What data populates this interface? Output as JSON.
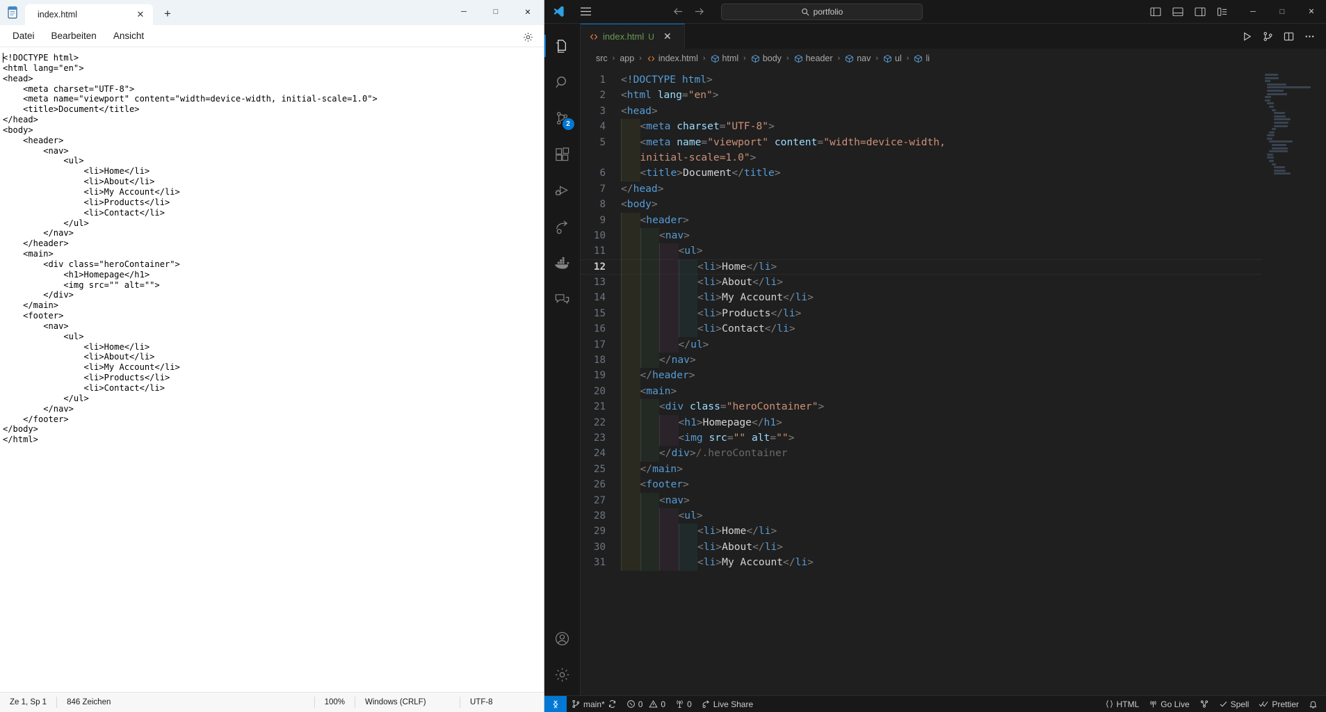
{
  "notepad": {
    "app_icon": "notepad-icon",
    "tab": {
      "label": "index.html",
      "close": "✕"
    },
    "new_tab": "+",
    "window_controls": {
      "minimize": "─",
      "maximize": "□",
      "close": "✕"
    },
    "menu": [
      "Datei",
      "Bearbeiten",
      "Ansicht"
    ],
    "settings_icon": "gear-icon",
    "content": "<!DOCTYPE html>\n<html lang=\"en\">\n<head>\n    <meta charset=\"UTF-8\">\n    <meta name=\"viewport\" content=\"width=device-width, initial-scale=1.0\">\n    <title>Document</title>\n</head>\n<body>\n    <header>\n        <nav>\n            <ul>\n                <li>Home</li>\n                <li>About</li>\n                <li>My Account</li>\n                <li>Products</li>\n                <li>Contact</li>\n            </ul>\n        </nav>\n    </header>\n    <main>\n        <div class=\"heroContainer\">\n            <h1>Homepage</h1>\n            <img src=\"\" alt=\"\">\n        </div>\n    </main>\n    <footer>\n        <nav>\n            <ul>\n                <li>Home</li>\n                <li>About</li>\n                <li>My Account</li>\n                <li>Products</li>\n                <li>Contact</li>\n            </ul>\n        </nav>\n    </footer>\n</body>\n</html>",
    "statusbar": {
      "position": "Ze 1, Sp 1",
      "characters": "846 Zeichen",
      "zoom": "100%",
      "line_ending": "Windows (CRLF)",
      "encoding": "UTF-8"
    }
  },
  "vscode": {
    "titlebar": {
      "logo": "vscode-logo-icon",
      "menu_icon": "hamburger-menu-icon",
      "back_icon": "arrow-left-icon",
      "forward_icon": "arrow-right-icon",
      "search_icon": "search-icon",
      "search_value": "portfolio",
      "layout_icons": [
        "toggle-primary-sidebar-icon",
        "toggle-panel-icon",
        "toggle-secondary-sidebar-icon",
        "customize-layout-icon"
      ],
      "window_controls": {
        "minimize": "─",
        "maximize": "□",
        "close": "✕"
      }
    },
    "activitybar": [
      {
        "name": "explorer",
        "icon": "files-icon",
        "badge": null,
        "active": true
      },
      {
        "name": "search",
        "icon": "search-icon",
        "badge": null,
        "active": false
      },
      {
        "name": "source-control",
        "icon": "source-control-icon",
        "badge": "2",
        "active": false
      },
      {
        "name": "extensions",
        "icon": "extensions-icon",
        "badge": null,
        "active": false
      },
      {
        "name": "run-and-debug",
        "icon": "run-debug-icon",
        "badge": null,
        "active": false
      },
      {
        "name": "live-share",
        "icon": "share-icon",
        "badge": null,
        "active": false
      },
      {
        "name": "docker",
        "icon": "docker-whale-icon",
        "badge": null,
        "active": false
      },
      {
        "name": "remote-explorer",
        "icon": "remote-window-icon",
        "badge": null,
        "active": false
      }
    ],
    "activitybar_bottom": [
      {
        "name": "accounts",
        "icon": "account-icon"
      },
      {
        "name": "settings",
        "icon": "gear-icon"
      }
    ],
    "tab": {
      "icon": "html-file-icon",
      "label": "index.html",
      "status_badge": "U",
      "close": "✕"
    },
    "editor_actions": [
      "run-file-icon",
      "split-and-compare-icon",
      "split-editor-icon",
      "more-actions-icon"
    ],
    "breadcrumb": [
      {
        "label": "src",
        "icon": null
      },
      {
        "label": "app",
        "icon": null
      },
      {
        "label": "index.html",
        "icon": "html-file-icon"
      },
      {
        "label": "html",
        "icon": "symbol-module-icon"
      },
      {
        "label": "body",
        "icon": "symbol-module-icon"
      },
      {
        "label": "header",
        "icon": "symbol-module-icon"
      },
      {
        "label": "nav",
        "icon": "symbol-module-icon"
      },
      {
        "label": "ul",
        "icon": "symbol-module-icon"
      },
      {
        "label": "li",
        "icon": "symbol-module-icon"
      }
    ],
    "breadcrumb_separator": "›",
    "code_lines": [
      {
        "n": 1,
        "indent": 0,
        "tokens": [
          [
            "ang",
            "<"
          ],
          [
            "doct",
            "!DOCTYPE "
          ],
          [
            "tag",
            "html"
          ],
          [
            "ang",
            ">"
          ]
        ]
      },
      {
        "n": 2,
        "indent": 0,
        "tokens": [
          [
            "ang",
            "<"
          ],
          [
            "tag",
            "html"
          ],
          [
            "txt",
            " "
          ],
          [
            "attr",
            "lang"
          ],
          [
            "ang",
            "="
          ],
          [
            "str",
            "\"en\""
          ],
          [
            "ang",
            ">"
          ]
        ]
      },
      {
        "n": 3,
        "indent": 0,
        "tokens": [
          [
            "ang",
            "<"
          ],
          [
            "tag",
            "head"
          ],
          [
            "ang",
            ">"
          ]
        ]
      },
      {
        "n": 4,
        "indent": 1,
        "tokens": [
          [
            "ang",
            "<"
          ],
          [
            "tag",
            "meta"
          ],
          [
            "txt",
            " "
          ],
          [
            "attr",
            "charset"
          ],
          [
            "ang",
            "="
          ],
          [
            "str",
            "\"UTF-8\""
          ],
          [
            "ang",
            ">"
          ]
        ]
      },
      {
        "n": 5,
        "indent": 1,
        "tokens": [
          [
            "ang",
            "<"
          ],
          [
            "tag",
            "meta"
          ],
          [
            "txt",
            " "
          ],
          [
            "attr",
            "name"
          ],
          [
            "ang",
            "="
          ],
          [
            "str",
            "\"viewport\""
          ],
          [
            "txt",
            " "
          ],
          [
            "attr",
            "content"
          ],
          [
            "ang",
            "="
          ],
          [
            "str",
            "\"width=device-width,"
          ]
        ]
      },
      {
        "n": "",
        "indent": 1,
        "wrap": true,
        "tokens": [
          [
            "str",
            "initial-scale=1.0\""
          ],
          [
            "ang",
            ">"
          ]
        ]
      },
      {
        "n": 6,
        "indent": 1,
        "tokens": [
          [
            "ang",
            "<"
          ],
          [
            "tag",
            "title"
          ],
          [
            "ang",
            ">"
          ],
          [
            "txt",
            "Document"
          ],
          [
            "ang",
            "</"
          ],
          [
            "tag",
            "title"
          ],
          [
            "ang",
            ">"
          ]
        ]
      },
      {
        "n": 7,
        "indent": 0,
        "tokens": [
          [
            "ang",
            "</"
          ],
          [
            "tag",
            "head"
          ],
          [
            "ang",
            ">"
          ]
        ]
      },
      {
        "n": 8,
        "indent": 0,
        "tokens": [
          [
            "ang",
            "<"
          ],
          [
            "tag",
            "body"
          ],
          [
            "ang",
            ">"
          ]
        ]
      },
      {
        "n": 9,
        "indent": 1,
        "tokens": [
          [
            "ang",
            "<"
          ],
          [
            "tag",
            "header"
          ],
          [
            "ang",
            ">"
          ]
        ]
      },
      {
        "n": 10,
        "indent": 2,
        "tokens": [
          [
            "ang",
            "<"
          ],
          [
            "tag",
            "nav"
          ],
          [
            "ang",
            ">"
          ]
        ]
      },
      {
        "n": 11,
        "indent": 3,
        "tokens": [
          [
            "ang",
            "<"
          ],
          [
            "tag",
            "ul"
          ],
          [
            "ang",
            ">"
          ]
        ]
      },
      {
        "n": 12,
        "indent": 4,
        "active": true,
        "tokens": [
          [
            "ang",
            "<"
          ],
          [
            "tag",
            "li"
          ],
          [
            "ang",
            ">"
          ],
          [
            "txt",
            "Home"
          ],
          [
            "ang",
            "</"
          ],
          [
            "tag",
            "li"
          ],
          [
            "ang",
            ">"
          ]
        ]
      },
      {
        "n": 13,
        "indent": 4,
        "tokens": [
          [
            "ang",
            "<"
          ],
          [
            "tag",
            "li"
          ],
          [
            "ang",
            ">"
          ],
          [
            "txt",
            "About"
          ],
          [
            "ang",
            "</"
          ],
          [
            "tag",
            "li"
          ],
          [
            "ang",
            ">"
          ]
        ]
      },
      {
        "n": 14,
        "indent": 4,
        "tokens": [
          [
            "ang",
            "<"
          ],
          [
            "tag",
            "li"
          ],
          [
            "ang",
            ">"
          ],
          [
            "txt",
            "My Account"
          ],
          [
            "ang",
            "</"
          ],
          [
            "tag",
            "li"
          ],
          [
            "ang",
            ">"
          ]
        ]
      },
      {
        "n": 15,
        "indent": 4,
        "tokens": [
          [
            "ang",
            "<"
          ],
          [
            "tag",
            "li"
          ],
          [
            "ang",
            ">"
          ],
          [
            "txt",
            "Products"
          ],
          [
            "ang",
            "</"
          ],
          [
            "tag",
            "li"
          ],
          [
            "ang",
            ">"
          ]
        ]
      },
      {
        "n": 16,
        "indent": 4,
        "tokens": [
          [
            "ang",
            "<"
          ],
          [
            "tag",
            "li"
          ],
          [
            "ang",
            ">"
          ],
          [
            "txt",
            "Contact"
          ],
          [
            "ang",
            "</"
          ],
          [
            "tag",
            "li"
          ],
          [
            "ang",
            ">"
          ]
        ]
      },
      {
        "n": 17,
        "indent": 3,
        "tokens": [
          [
            "ang",
            "</"
          ],
          [
            "tag",
            "ul"
          ],
          [
            "ang",
            ">"
          ]
        ]
      },
      {
        "n": 18,
        "indent": 2,
        "tokens": [
          [
            "ang",
            "</"
          ],
          [
            "tag",
            "nav"
          ],
          [
            "ang",
            ">"
          ]
        ]
      },
      {
        "n": 19,
        "indent": 1,
        "tokens": [
          [
            "ang",
            "</"
          ],
          [
            "tag",
            "header"
          ],
          [
            "ang",
            ">"
          ]
        ]
      },
      {
        "n": 20,
        "indent": 1,
        "tokens": [
          [
            "ang",
            "<"
          ],
          [
            "tag",
            "main"
          ],
          [
            "ang",
            ">"
          ]
        ]
      },
      {
        "n": 21,
        "indent": 2,
        "tokens": [
          [
            "ang",
            "<"
          ],
          [
            "tag",
            "div"
          ],
          [
            "txt",
            " "
          ],
          [
            "attr",
            "class"
          ],
          [
            "ang",
            "="
          ],
          [
            "str",
            "\"heroContainer\""
          ],
          [
            "ang",
            ">"
          ]
        ]
      },
      {
        "n": 22,
        "indent": 3,
        "tokens": [
          [
            "ang",
            "<"
          ],
          [
            "tag",
            "h1"
          ],
          [
            "ang",
            ">"
          ],
          [
            "txt",
            "Homepage"
          ],
          [
            "ang",
            "</"
          ],
          [
            "tag",
            "h1"
          ],
          [
            "ang",
            ">"
          ]
        ]
      },
      {
        "n": 23,
        "indent": 3,
        "tokens": [
          [
            "ang",
            "<"
          ],
          [
            "tag",
            "img"
          ],
          [
            "txt",
            " "
          ],
          [
            "attr",
            "src"
          ],
          [
            "ang",
            "="
          ],
          [
            "str",
            "\"\""
          ],
          [
            "txt",
            " "
          ],
          [
            "attr",
            "alt"
          ],
          [
            "ang",
            "="
          ],
          [
            "str",
            "\"\""
          ],
          [
            "ang",
            ">"
          ]
        ]
      },
      {
        "n": 24,
        "indent": 2,
        "tokens": [
          [
            "ang",
            "</"
          ],
          [
            "tag",
            "div"
          ],
          [
            "ang",
            ">"
          ],
          [
            "hint",
            "/.heroContainer"
          ]
        ]
      },
      {
        "n": 25,
        "indent": 1,
        "tokens": [
          [
            "ang",
            "</"
          ],
          [
            "tag",
            "main"
          ],
          [
            "ang",
            ">"
          ]
        ]
      },
      {
        "n": 26,
        "indent": 1,
        "tokens": [
          [
            "ang",
            "<"
          ],
          [
            "tag",
            "footer"
          ],
          [
            "ang",
            ">"
          ]
        ]
      },
      {
        "n": 27,
        "indent": 2,
        "tokens": [
          [
            "ang",
            "<"
          ],
          [
            "tag",
            "nav"
          ],
          [
            "ang",
            ">"
          ]
        ]
      },
      {
        "n": 28,
        "indent": 3,
        "tokens": [
          [
            "ang",
            "<"
          ],
          [
            "tag",
            "ul"
          ],
          [
            "ang",
            ">"
          ]
        ]
      },
      {
        "n": 29,
        "indent": 4,
        "tokens": [
          [
            "ang",
            "<"
          ],
          [
            "tag",
            "li"
          ],
          [
            "ang",
            ">"
          ],
          [
            "txt",
            "Home"
          ],
          [
            "ang",
            "</"
          ],
          [
            "tag",
            "li"
          ],
          [
            "ang",
            ">"
          ]
        ]
      },
      {
        "n": 30,
        "indent": 4,
        "tokens": [
          [
            "ang",
            "<"
          ],
          [
            "tag",
            "li"
          ],
          [
            "ang",
            ">"
          ],
          [
            "txt",
            "About"
          ],
          [
            "ang",
            "</"
          ],
          [
            "tag",
            "li"
          ],
          [
            "ang",
            ">"
          ]
        ]
      },
      {
        "n": 31,
        "indent": 4,
        "tokens": [
          [
            "ang",
            "<"
          ],
          [
            "tag",
            "li"
          ],
          [
            "ang",
            ">"
          ],
          [
            "txt",
            "My Account"
          ],
          [
            "ang",
            "</"
          ],
          [
            "tag",
            "li"
          ],
          [
            "ang",
            ">"
          ]
        ]
      }
    ],
    "statusbar": {
      "remote_icon": "remote-indicator-icon",
      "branch": "main*",
      "sync_icon": "sync-icon",
      "errors": "0",
      "warnings": "0",
      "ports": "0",
      "live_share": "Live Share",
      "language": "HTML",
      "go_live": "Go Live",
      "spell": "Spell",
      "prettier": "Prettier",
      "bell_icon": "bell-icon"
    }
  },
  "colors": {
    "accent": "#0078d4",
    "tag": "#569cd6",
    "attr": "#9cdcfe",
    "string": "#ce9178",
    "text": "#d4d4d4",
    "tab_label": "#6a9955",
    "vs_bg": "#1f1f1f",
    "vs_chrome": "#181818",
    "notepad_bg": "#ffffff"
  }
}
